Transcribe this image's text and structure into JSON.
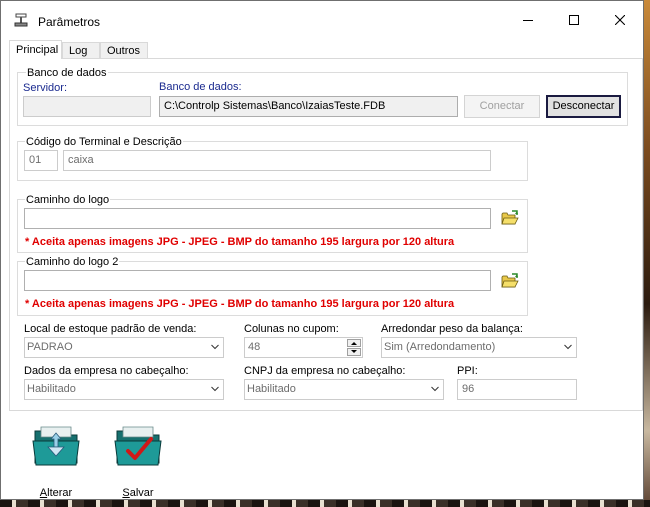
{
  "window": {
    "title": "Parâmetros"
  },
  "tabs": [
    {
      "label": "Principal"
    },
    {
      "label": "Log"
    },
    {
      "label": "Outros"
    }
  ],
  "db": {
    "group_label": "Banco de dados",
    "server_label": "Servidor:",
    "server_value": "",
    "path_label": "Banco de dados:",
    "path_value": "C:\\Controlp Sistemas\\Banco\\IzaiasTeste.FDB",
    "connect_label": "Conectar",
    "disconnect_label": "Desconectar"
  },
  "terminal": {
    "group_label": "Código do Terminal e Descrição",
    "code": "01",
    "description": "caixa"
  },
  "logo": {
    "label": "Caminho do logo",
    "value": "",
    "note": "* Aceita apenas imagens JPG - JPEG - BMP do tamanho 195 largura por 120 altura"
  },
  "logo2": {
    "label": "Caminho do logo 2",
    "value": "",
    "note": "* Aceita apenas imagens JPG - JPEG - BMP do tamanho 195 largura por 120 altura"
  },
  "fields": {
    "stock_label": "Local de estoque padrão de venda:",
    "stock_value": "PADRAO",
    "columns_label": "Colunas no cupom:",
    "columns_value": "48",
    "round_label": "Arredondar peso da balança:",
    "round_value": "Sim (Arredondamento)",
    "company_header_label": "Dados da empresa no cabeçalho:",
    "company_header_value": "Habilitado",
    "cnpj_label": "CNPJ da empresa no cabeçalho:",
    "cnpj_value": "Habilitado",
    "ppi_label": "PPI:",
    "ppi_value": "96"
  },
  "actions": {
    "alter_label": "Alterar",
    "save_label": "Salvar"
  },
  "icons": {
    "app": "scale-icon",
    "folder": "open-folder-icon",
    "alter": "edit-folder-icon",
    "save": "checkmark-folder-icon"
  },
  "colors": {
    "note_red": "#e00000",
    "label_blue": "#1a2a8f",
    "folder_teal": "#1e8c8c"
  }
}
